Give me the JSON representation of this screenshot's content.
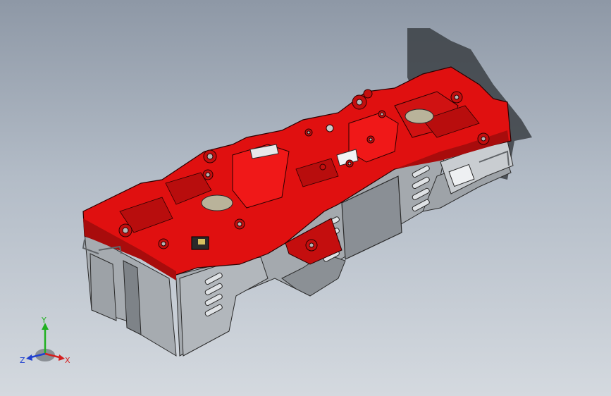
{
  "viewport": {
    "background_top": "#8e98a6",
    "background_bottom": "#d4d9df"
  },
  "model": {
    "housing_color": "#e01010",
    "housing_shadow": "#a80c0c",
    "base_color": "#a6abb0",
    "base_dark": "#7e8388",
    "panel_color": "#8a8f95"
  },
  "triad": {
    "x_label": "X",
    "y_label": "Y",
    "z_label": "Z",
    "x_color": "#d42020",
    "y_color": "#20b020",
    "z_color": "#2040d0",
    "x_icon": "x-axis-arrow-icon",
    "y_icon": "y-axis-arrow-icon",
    "z_icon": "z-axis-arrow-icon"
  }
}
